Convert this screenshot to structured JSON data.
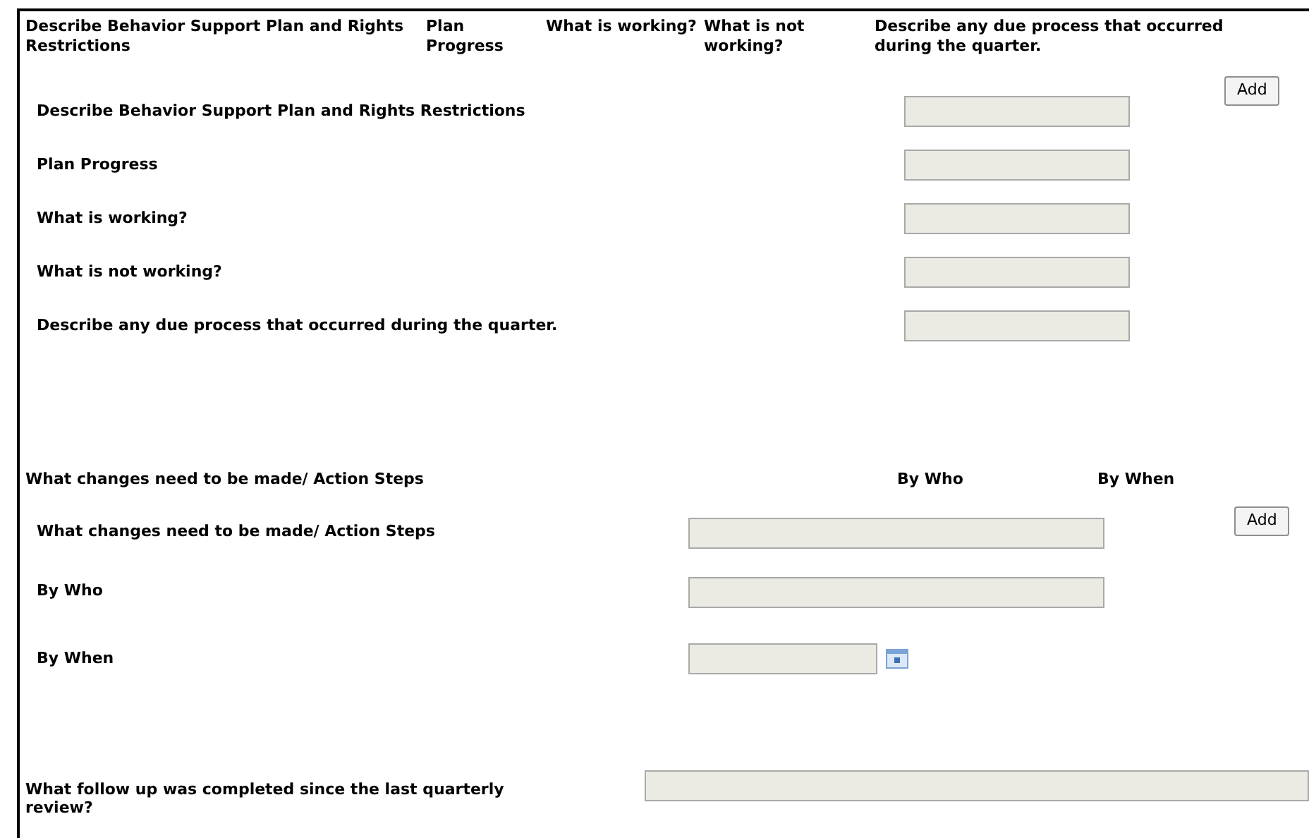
{
  "plan_section": {
    "columns": [
      "Describe Behavior Support Plan and Rights Restrictions",
      "Plan Progress",
      "What is working?",
      "What is not working?",
      "Describe any due process that occurred during the quarter."
    ],
    "fields": [
      {
        "label": "Describe Behavior Support Plan and Rights Restrictions",
        "kind": "text"
      },
      {
        "label": "Plan Progress",
        "kind": "text"
      },
      {
        "label": "What is working?",
        "kind": "text"
      },
      {
        "label": "What is not working?",
        "kind": "text"
      },
      {
        "label": "Describe any due process that occurred during the quarter.",
        "kind": "text"
      }
    ],
    "add_button": "Add"
  },
  "action_section": {
    "columns": [
      "What changes need to be made/ Action Steps",
      "By Who",
      "By When"
    ],
    "fields": [
      {
        "label": "What changes need to be made/ Action Steps",
        "kind": "text"
      },
      {
        "label": "By Who",
        "kind": "text"
      },
      {
        "label": "By When",
        "kind": "date"
      }
    ],
    "add_button": "Add"
  },
  "follow_up": {
    "label": "What follow up was completed since the last quarterly review?"
  }
}
